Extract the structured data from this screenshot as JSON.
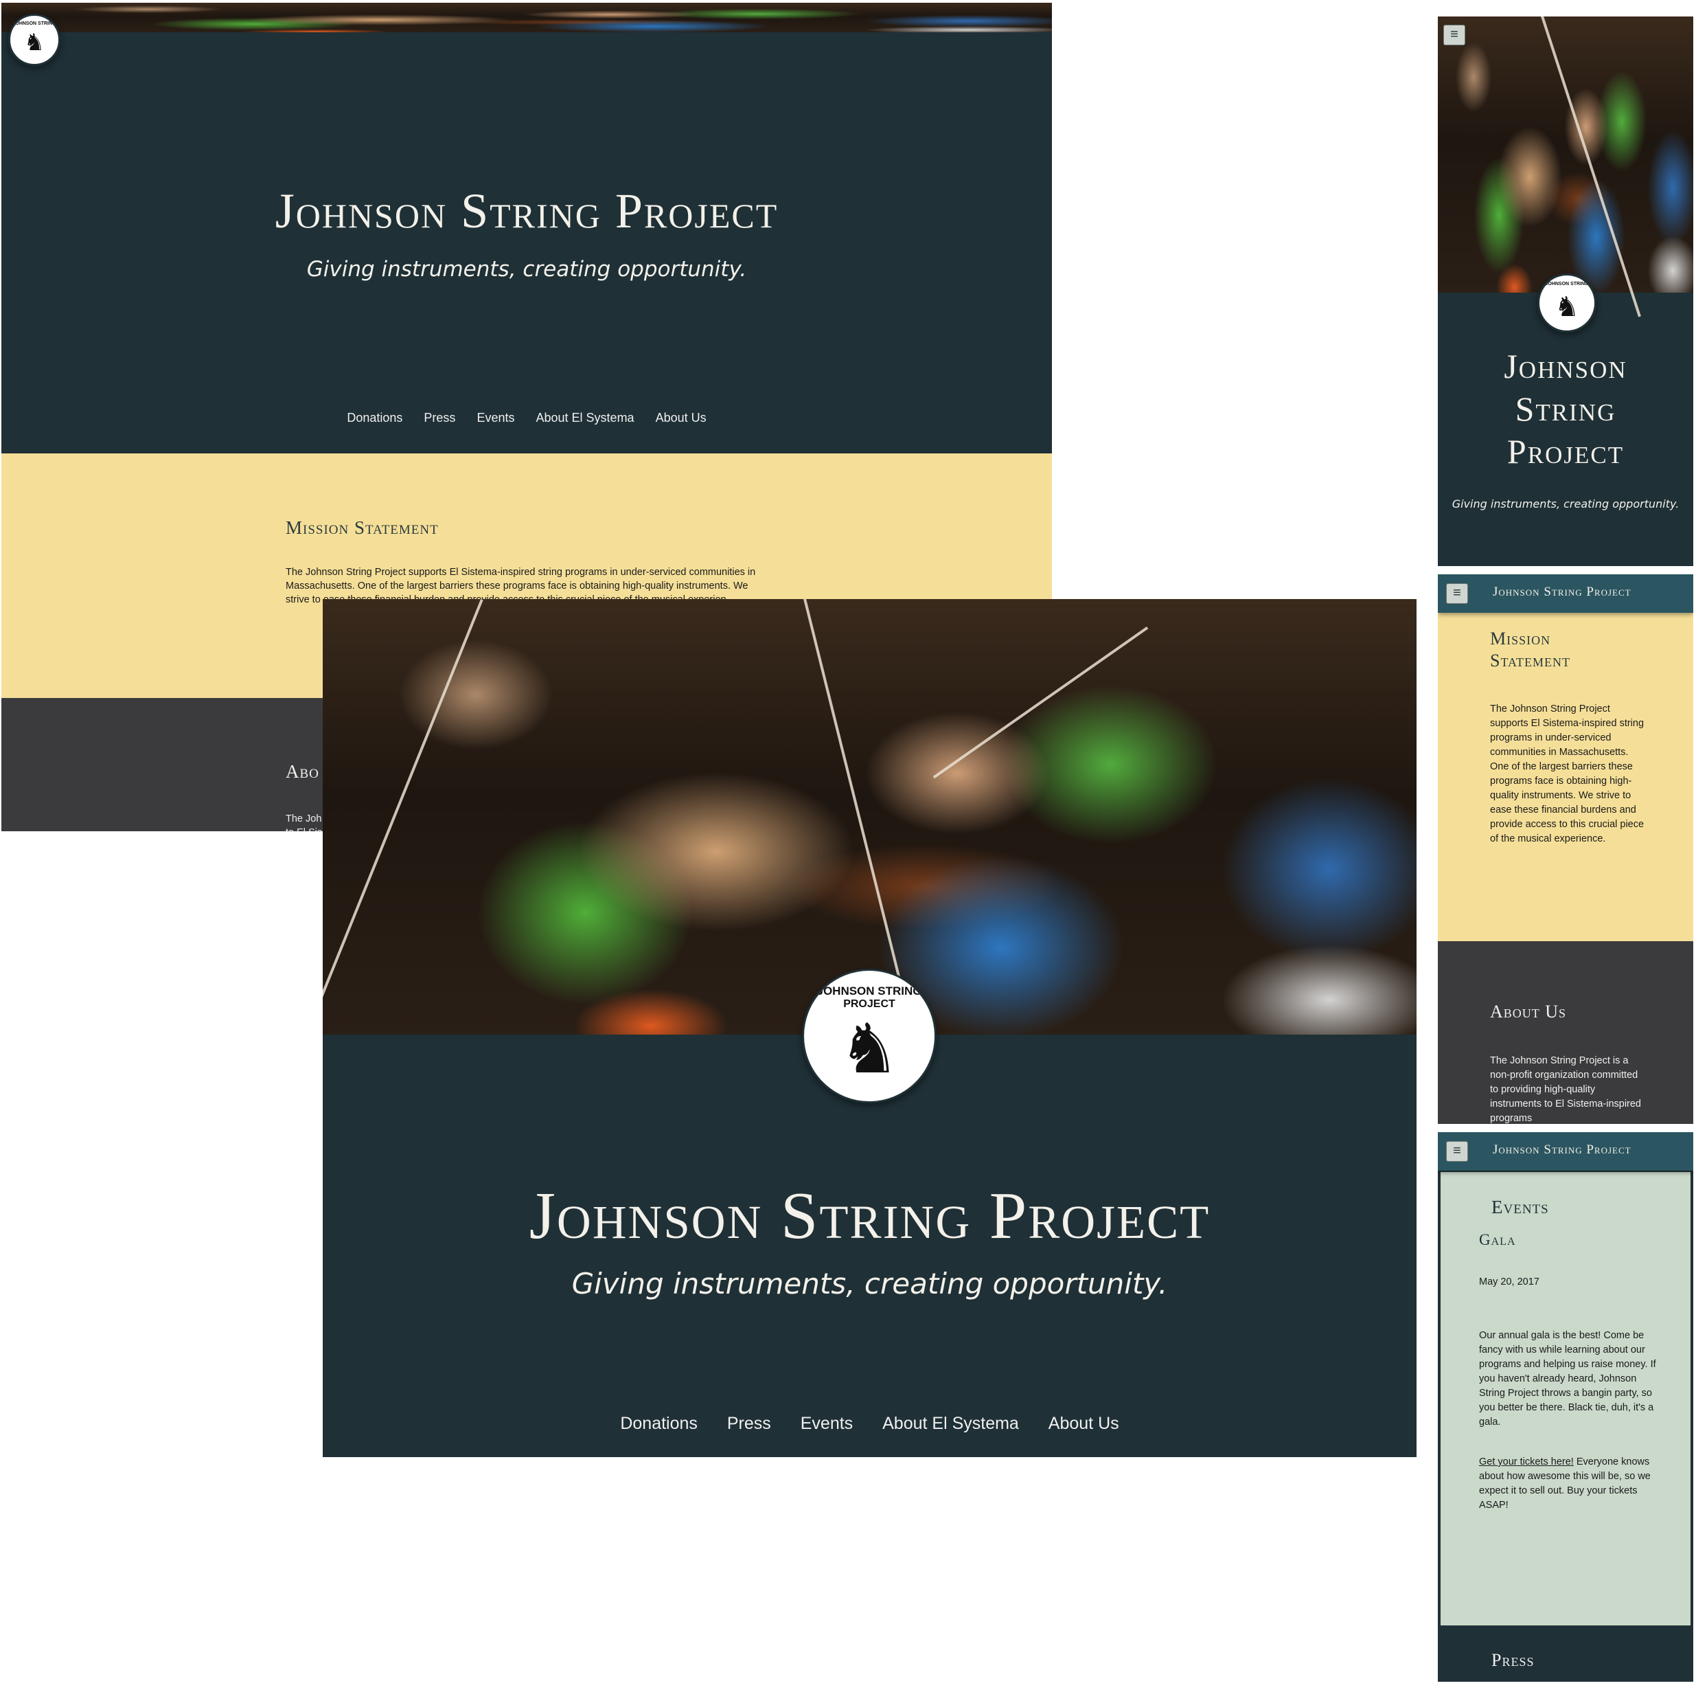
{
  "site": {
    "title": "Johnson String Project",
    "tagline": "Giving instruments, creating opportunity.",
    "logo_text_top": "JOHNSON STRING",
    "logo_text_bottom": "PROJECT"
  },
  "nav": [
    "Donations",
    "Press",
    "Events",
    "About El Systema",
    "About Us"
  ],
  "mission": {
    "heading": "Mission Statement",
    "desktop_text": "The Johnson String Project supports El Sistema-inspired string programs in under-serviced communities in Massachusetts. One of the largest barriers these programs face is obtaining high-quality instruments. We strive to ease these financial burden and provide access to this crucial piece of the musical experien",
    "mobile_text": "The Johnson String Project supports El Sistema-inspired string programs in under-serviced communities in Massachusetts. One of the largest barriers these programs face is obtaining high-quality instruments. We strive to ease these financial burdens and provide access to this crucial piece of the musical experience."
  },
  "about": {
    "heading": "About Us",
    "desktop_heading_partial": "Abo",
    "desktop_text_partial_1": "The Joh",
    "desktop_text_partial_2": "to El Sis",
    "mobile_text": "The Johnson String Project is a non-profit organization committed to providing high-quality instruments to El Sistema-inspired programs"
  },
  "events": {
    "heading": "Events",
    "item_title": "Gala",
    "date": "May 20, 2017",
    "description": "Our annual gala is the best! Come be fancy with us while learning about our programs and helping us raise money. If you haven't already heard, Johnson String Project throws a bangin party, so you better be there. Black tie, duh, it's a gala.",
    "ticket_link": "Get your tickets here!",
    "ticket_text": " Everyone knows about how awesome this will be, so we expect it to sell out. Buy your tickets ASAP!"
  },
  "press": {
    "heading": "Press"
  },
  "icons": {
    "menu": "hamburger-menu-icon",
    "logo": "violinist-silhouette-icon"
  },
  "colors": {
    "dark_teal": "#1f3036",
    "header_teal": "#2b5560",
    "mission_yellow": "#f5df98",
    "about_gray": "#3b3b3d",
    "events_mint": "#cad9ca"
  }
}
